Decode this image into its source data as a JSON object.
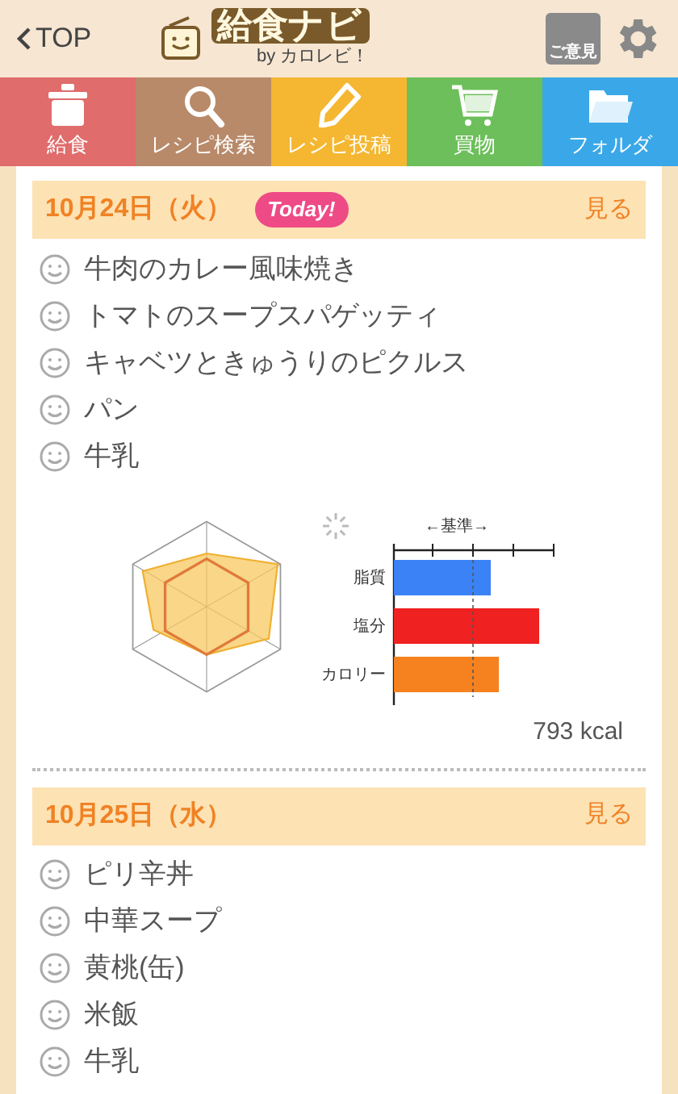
{
  "header": {
    "back": "TOP",
    "logo": "給食ナビ",
    "byline": "by カロレビ！",
    "feedback": "ご意見"
  },
  "nav": [
    {
      "label": "給食",
      "kind": "pot",
      "color": "#e06c6c"
    },
    {
      "label": "レシピ検索",
      "kind": "search",
      "color": "#b88a6a"
    },
    {
      "label": "レシピ投稿",
      "kind": "pencil",
      "color": "#f5b731"
    },
    {
      "label": "買物",
      "kind": "cart",
      "color": "#6cbf5a"
    },
    {
      "label": "フォルダ",
      "kind": "folder",
      "color": "#3aa8e8"
    }
  ],
  "days": [
    {
      "date": "10月24日（火）",
      "today": true,
      "today_label": "Today!",
      "view": "見る",
      "items": [
        "牛肉のカレー風味焼き",
        "トマトのスープスパゲッティ",
        "キャベツときゅうりのピクルス",
        "パン",
        "牛乳"
      ],
      "chart": {
        "axis_title": "←基準→",
        "labels": [
          "脂質",
          "塩分",
          "カロリー"
        ]
      },
      "kcal": "793 kcal"
    },
    {
      "date": "10月25日（水）",
      "today": false,
      "view": "見る",
      "items": [
        "ピリ辛丼",
        "中華スープ",
        "黄桃(缶)",
        "米飯",
        "牛乳"
      ]
    }
  ]
}
